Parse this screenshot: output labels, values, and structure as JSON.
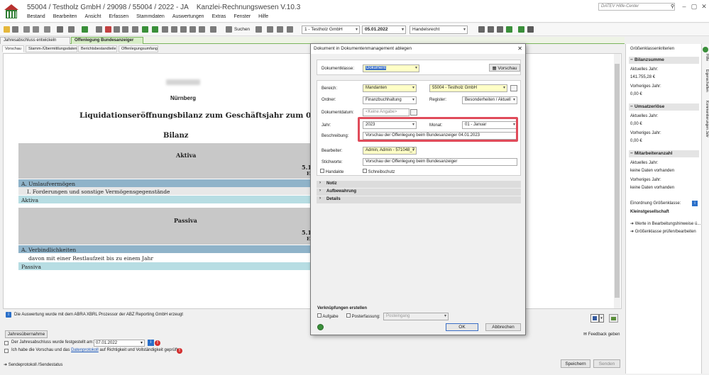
{
  "app": {
    "title": "55004 / Testholz GmbH / 29098 / 55004 / 2022 - JA",
    "product": "Kanzlei-Rechnungswesen V.10.3",
    "help_search_placeholder": "DATEV Hilfe-Center",
    "menu": [
      "Bestand",
      "Bearbeiten",
      "Ansicht",
      "Erfassen",
      "Stammdaten",
      "Auswertungen",
      "Extras",
      "Fenster",
      "Hilfe"
    ]
  },
  "toolbar": {
    "search_label": "Suchen",
    "company_select": "1 - Testholz GmbH",
    "date_value": "05.01.2022",
    "law_select": "Handelsrecht"
  },
  "doc_tabs": [
    "Jahresabschluss entwickeln",
    "Offenlegung Bundesanzeiger"
  ],
  "sub_tabs": [
    "Vorschau",
    "Stamm-/Übermittlungsdaten",
    "Berichtsbestandteile",
    "Offenlegungsumfang"
  ],
  "report": {
    "city": "Nürnberg",
    "title": "Liquidationseröffnungsbilanz zum Geschäftsjahr zum 05.01.2022",
    "bilanz": "Bilanz",
    "aktiva_header": "Aktiva",
    "aktiva_date_fragment": "5.1",
    "aktiva_date_fragment2": "E",
    "aktiva_rows": [
      {
        "type": "section",
        "text": "A. Umlaufvermögen"
      },
      {
        "type": "row",
        "text": "I. Forderungen und sonstige Vermögensgegenstände"
      },
      {
        "type": "total",
        "text": "Aktiva"
      }
    ],
    "passiva_header": "Passiva",
    "passiva_date_fragment": "5.1",
    "passiva_date_fragment2": "E",
    "passiva_rows": [
      {
        "type": "section",
        "text": "A. Verbindlichkeiten"
      },
      {
        "type": "row",
        "text": "davon mit einer Restlaufzeit bis zu einem Jahr"
      },
      {
        "type": "total",
        "text": "Passiva"
      }
    ],
    "footer_info": "Die Auswertung wurde mit dem ABRA XBRL Prozessor der ABZ Reporting GmbH erzeugt"
  },
  "bottom": {
    "jahresuebernahme": "Jahresübernahme",
    "festgestellt_label": "Der Jahresabschluss wurde festgestellt am:",
    "festgestellt_date": "07.01.2022",
    "pruef_text_1": "Ich habe die Vorschau und das",
    "pruef_link": "Datenprotokoll",
    "pruef_text_2": "auf Richtigkeit und Vollständigkeit geprüft.",
    "sendeprotokoll": "Sendeprotokoll /Sendestatus",
    "feedback": "Feedback geben",
    "speichern": "Speichern",
    "senden": "Senden"
  },
  "right_panel": {
    "title": "Größenklassenkriterien",
    "bilanzsumme": {
      "header": "Bilanzsumme",
      "current_label": "Aktuelles Jahr:",
      "current_value": "141.755,28 €",
      "prev_label": "Vorheriges Jahr:",
      "prev_value": "0,00 €"
    },
    "umsatzerloese": {
      "header": "Umsatzerlöse",
      "current_label": "Aktuelles Jahr:",
      "current_value": "0,00 €",
      "prev_label": "Vorheriges Jahr:",
      "prev_value": "0,00 €"
    },
    "mitarbeiter": {
      "header": "Mitarbeiteranzahl",
      "current_label": "Aktuelles Jahr:",
      "current_value": "keine Daten vorhanden",
      "prev_label": "Vorheriges Jahr:",
      "prev_value": "keine Daten vorhanden"
    },
    "einordnung_label": "Einordnung Größenklasse:",
    "einordnung_value": "Kleinstgesellschaft",
    "link1": "Werte in Bearbeitungshinweise ü...",
    "link2": "Größenklasse prüfen/bearbeiten",
    "vertical_tabs": [
      "Hilfe",
      "Eigenschaften",
      "Kommentierungen Jahr"
    ]
  },
  "dialog": {
    "title": "Dokument in Dokumentenmanagement ablegen",
    "dokumentklasse_label": "Dokumentklasse:",
    "dokumentklasse_value": "Dokument",
    "vorschau_button": "Vorschau",
    "bereich_label": "Bereich:",
    "bereich_value": "Mandanten",
    "mandant_value": "55004 - Testholz GmbH",
    "ordner_label": "Ordner:",
    "ordner_value": "Finanzbuchhaltung",
    "register_label": "Register:",
    "register_value": "Besonderheiten / Aktuell",
    "dokumentdatum_label": "Dokumentdatum:",
    "dokumentdatum_placeholder": "<Keine Angabe>",
    "jahr_label": "Jahr:",
    "jahr_value": "2023",
    "monat_label": "Monat:",
    "monat_value": "01 - Januar",
    "beschreibung_label": "Beschreibung:",
    "beschreibung_value": "Vorschau der Offenlegung beim Bundesanzeiger 04.01.2023",
    "bearbeiter_label": "Bearbeiter:",
    "bearbeiter_value": "Admin, Admin - 571048_7",
    "stichworte_label": "Stichworte:",
    "stichworte_value": "Vorschau der Offenlegung beim Bundesanzeiger",
    "handakte": "Handakte",
    "schreibschutz": "Schreibschutz",
    "sections": [
      "Notiz",
      "Aufbewahrung",
      "Details"
    ],
    "verknuepfungen_label": "Verknüpfungen erstellen",
    "aufgabe": "Aufgabe",
    "posterfassung": "Posterfassung:",
    "posteingang": "Posteingang",
    "ok": "OK",
    "abbrechen": "Abbrechen"
  },
  "colors": {
    "accent_green": "#7ab55c",
    "highlight_red": "#e04b5a",
    "section_blue": "#8fb3c9",
    "total_teal": "#b7dde3"
  }
}
